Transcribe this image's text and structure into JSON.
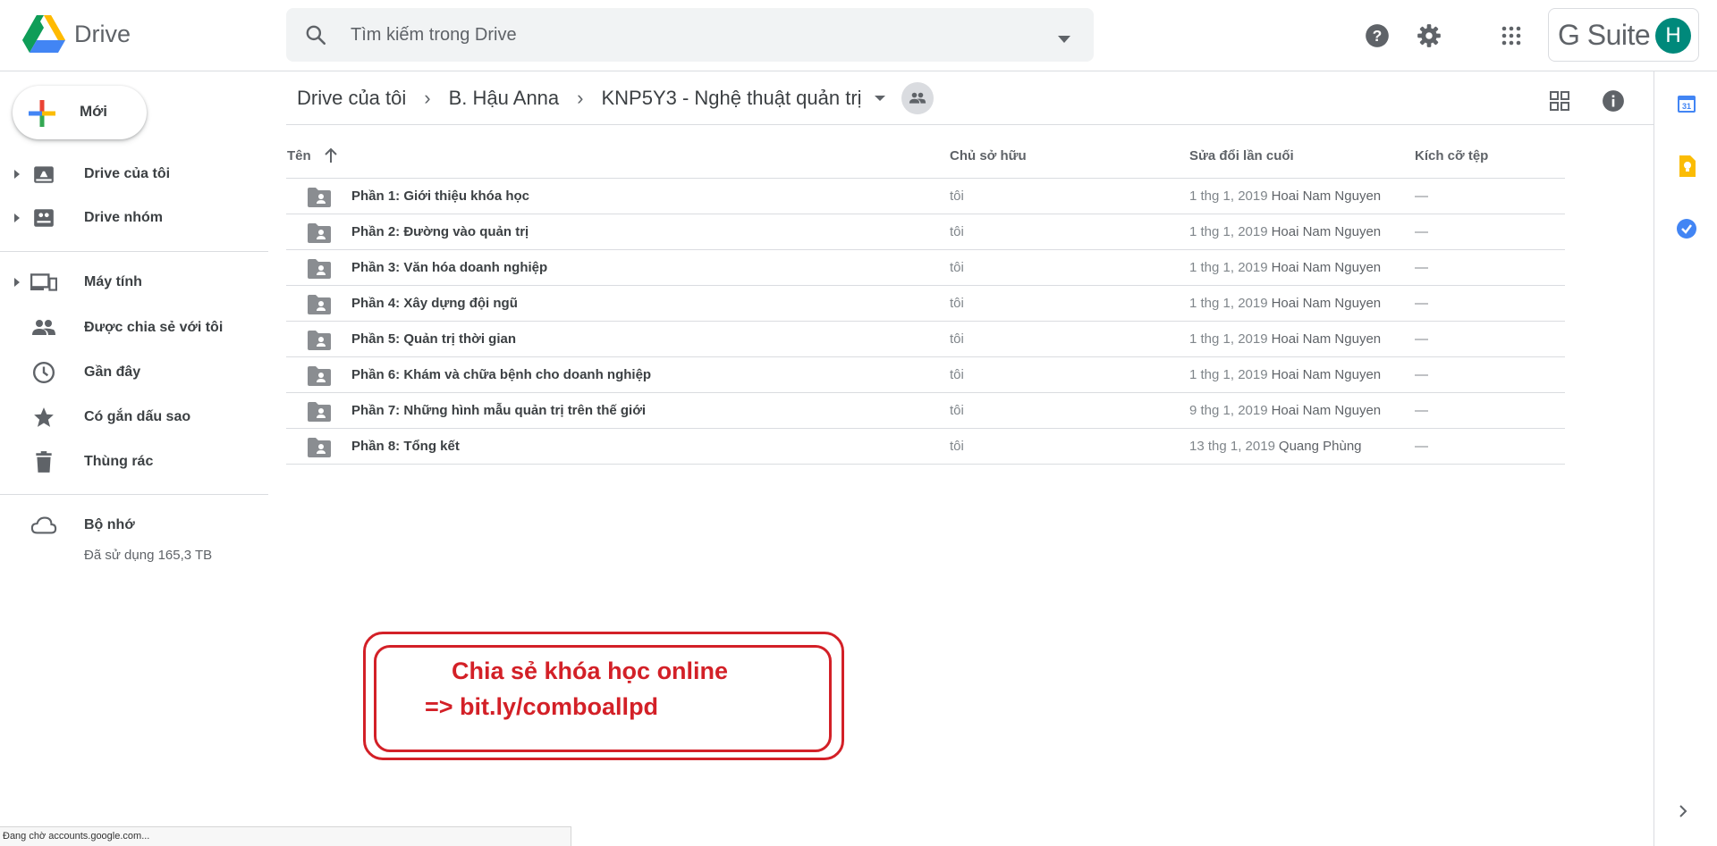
{
  "app": {
    "name": "Drive",
    "product": "G Suite",
    "avatar_letter": "H",
    "avatar_color": "#00897b"
  },
  "search": {
    "placeholder": "Tìm kiếm trong Drive"
  },
  "sidebar": {
    "new_label": "Mới",
    "items": [
      {
        "label": "Drive của tôi",
        "icon": "my-drive-icon"
      },
      {
        "label": "Drive nhóm",
        "icon": "shared-drives-icon"
      },
      {
        "label": "Máy tính",
        "icon": "computers-icon"
      },
      {
        "label": "Được chia sẻ với tôi",
        "icon": "shared-with-me-icon"
      },
      {
        "label": "Gần đây",
        "icon": "recent-icon"
      },
      {
        "label": "Có gắn dấu sao",
        "icon": "starred-icon"
      },
      {
        "label": "Thùng rác",
        "icon": "trash-icon"
      }
    ],
    "storage": {
      "label": "Bộ nhớ",
      "used": "Đã sử dụng 165,3 TB"
    }
  },
  "breadcrumb": [
    "Drive của tôi",
    "B. Hậu Anna",
    "KNP5Y3 - Nghệ thuật quản trị"
  ],
  "table": {
    "headers": {
      "name": "Tên",
      "owner": "Chủ sở hữu",
      "modified": "Sửa đổi lần cuối",
      "size": "Kích cỡ tệp"
    },
    "rows": [
      {
        "name": "Phần 1: Giới thiệu khóa học",
        "owner": "tôi",
        "modified": "1 thg 1, 2019",
        "modified_by": "Hoai Nam Nguyen",
        "size": "—"
      },
      {
        "name": "Phần 2: Đường vào quản trị",
        "owner": "tôi",
        "modified": "1 thg 1, 2019",
        "modified_by": "Hoai Nam Nguyen",
        "size": "—"
      },
      {
        "name": "Phần 3: Văn hóa doanh nghiệp",
        "owner": "tôi",
        "modified": "1 thg 1, 2019",
        "modified_by": "Hoai Nam Nguyen",
        "size": "—"
      },
      {
        "name": "Phần 4: Xây dựng đội ngũ",
        "owner": "tôi",
        "modified": "1 thg 1, 2019",
        "modified_by": "Hoai Nam Nguyen",
        "size": "—"
      },
      {
        "name": "Phần 5: Quản trị thời gian",
        "owner": "tôi",
        "modified": "1 thg 1, 2019",
        "modified_by": "Hoai Nam Nguyen",
        "size": "—"
      },
      {
        "name": "Phần 6: Khám và chữa bệnh cho doanh nghiệp",
        "owner": "tôi",
        "modified": "1 thg 1, 2019",
        "modified_by": "Hoai Nam Nguyen",
        "size": "—"
      },
      {
        "name": "Phần 7: Những hình mẫu quản trị trên thế giới",
        "owner": "tôi",
        "modified": "9 thg 1, 2019",
        "modified_by": "Hoai Nam Nguyen",
        "size": "—"
      },
      {
        "name": "Phần 8: Tổng kết",
        "owner": "tôi",
        "modified": "13 thg 1, 2019",
        "modified_by": "Quang Phùng",
        "size": "—"
      }
    ]
  },
  "side_apps": [
    "calendar-icon",
    "keep-icon",
    "tasks-icon"
  ],
  "promo": {
    "line1": "Chia sẻ khóa học online",
    "line2": "=> bit.ly/comboallpd",
    "color": "#d32027"
  },
  "status_bar": "Đang chờ accounts.google.com..."
}
